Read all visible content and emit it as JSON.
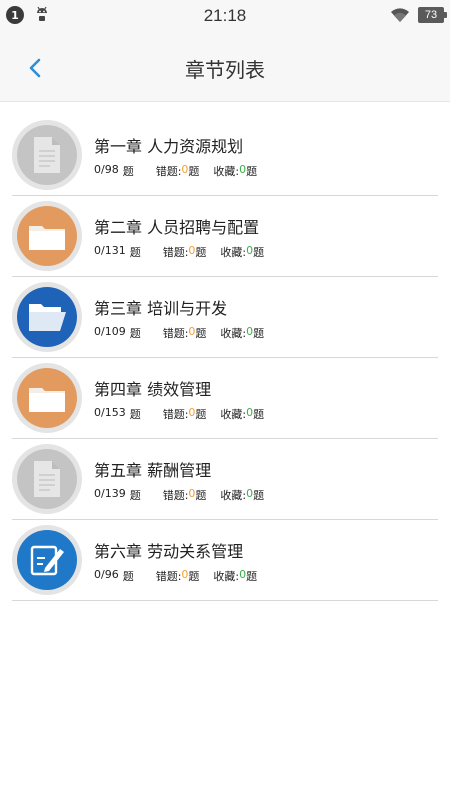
{
  "status_bar": {
    "notification_count": "1",
    "time": "21:18",
    "battery": "73"
  },
  "header": {
    "title": "章节列表"
  },
  "labels": {
    "questions_unit": "题",
    "wrong_label": "错题:",
    "fav_label": "收藏:"
  },
  "colors": {
    "accent_blue": "#2a8fd8",
    "wrong_count": "#f0a030",
    "fav_count": "#3cb04a"
  },
  "chapters": [
    {
      "title": "第一章 人力资源规划",
      "progress": "0/98",
      "wrong": "0",
      "fav": "0",
      "icon": "document-icon"
    },
    {
      "title": "第二章 人员招聘与配置",
      "progress": "0/131",
      "wrong": "0",
      "fav": "0",
      "icon": "folder-icon"
    },
    {
      "title": "第三章 培训与开发",
      "progress": "0/109",
      "wrong": "0",
      "fav": "0",
      "icon": "open-folder-icon"
    },
    {
      "title": "第四章 绩效管理",
      "progress": "0/153",
      "wrong": "0",
      "fav": "0",
      "icon": "folder-icon"
    },
    {
      "title": "第五章 薪酬管理",
      "progress": "0/139",
      "wrong": "0",
      "fav": "0",
      "icon": "document-icon"
    },
    {
      "title": "第六章 劳动关系管理",
      "progress": "0/96",
      "wrong": "0",
      "fav": "0",
      "icon": "edit-icon"
    }
  ]
}
